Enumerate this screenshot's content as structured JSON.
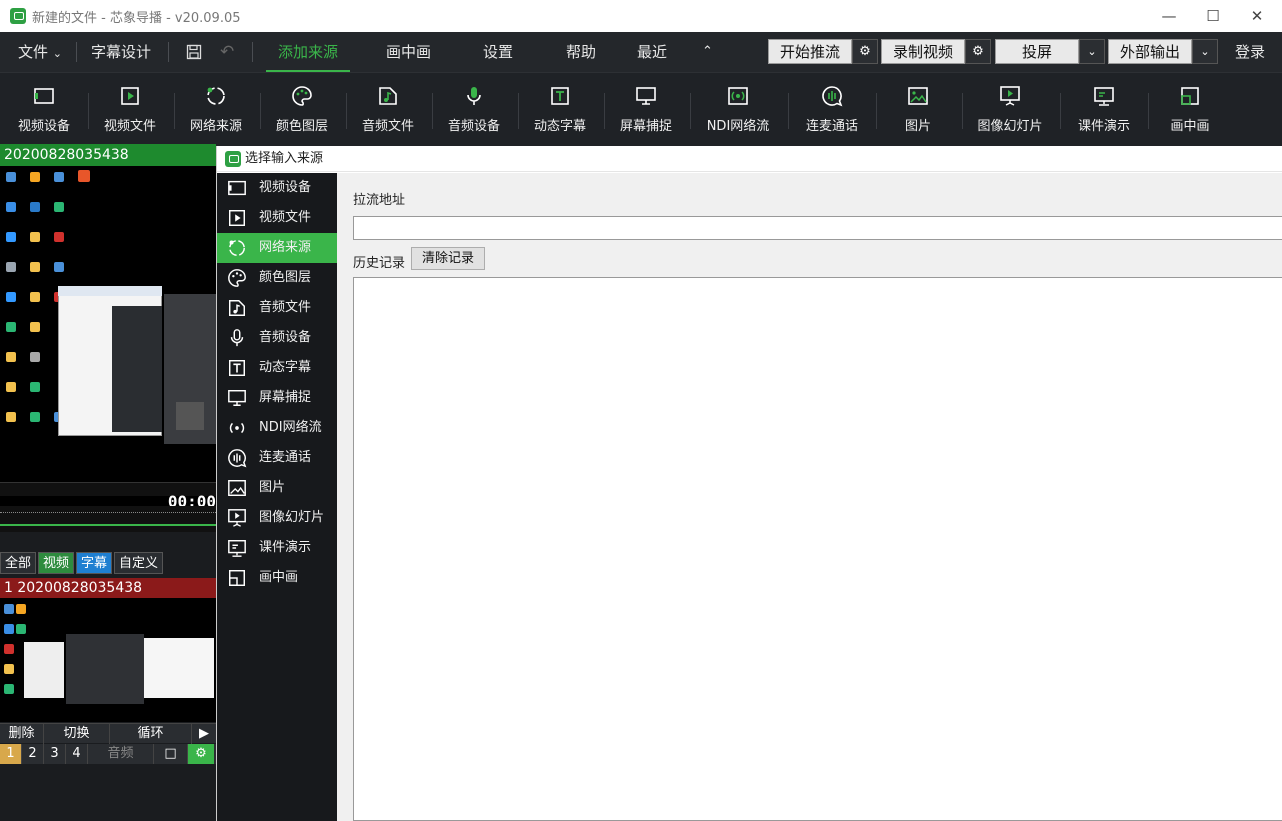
{
  "titlebar": {
    "title": "新建的文件 - 芯象导播 - v20.09.05",
    "minimize_icon": "minimize-icon",
    "maximize_icon": "maximize-icon",
    "close_icon": "close-icon"
  },
  "menubar": {
    "file": "文件",
    "subtitle_design": "字幕设计",
    "add_source": "添加来源",
    "pip": "画中画",
    "settings": "设置",
    "help": "帮助",
    "recent": "最近",
    "start_push": "开始推流",
    "record_video": "录制视频",
    "cast": "投屏",
    "external_output": "外部输出",
    "login": "登录"
  },
  "toolbar": {
    "items": [
      {
        "label": "视频设备",
        "icon": "video-device-icon"
      },
      {
        "label": "视频文件",
        "icon": "video-file-icon"
      },
      {
        "label": "网络来源",
        "icon": "network-source-icon"
      },
      {
        "label": "颜色图层",
        "icon": "palette-icon"
      },
      {
        "label": "音频文件",
        "icon": "audio-file-icon"
      },
      {
        "label": "音频设备",
        "icon": "microphone-icon"
      },
      {
        "label": "动态字幕",
        "icon": "text-icon"
      },
      {
        "label": "屏幕捕捉",
        "icon": "monitor-icon"
      },
      {
        "label": "NDI网络流",
        "icon": "ndi-icon"
      },
      {
        "label": "连麦通话",
        "icon": "voice-chat-icon"
      },
      {
        "label": "图片",
        "icon": "image-icon"
      },
      {
        "label": "图像幻灯片",
        "icon": "slideshow-icon"
      },
      {
        "label": "课件演示",
        "icon": "courseware-icon"
      },
      {
        "label": "画中画",
        "icon": "pip-icon"
      }
    ]
  },
  "left_panel": {
    "preview_title": "20200828035438",
    "timecode": "00:00",
    "filters": [
      "全部",
      "视频",
      "字幕",
      "自定义"
    ],
    "list_item_title": "1 20200828035438",
    "controls": [
      "删除",
      "切换",
      "循环"
    ],
    "numbers": [
      "1",
      "2",
      "3",
      "4"
    ],
    "audio_label": "音频"
  },
  "dialog": {
    "title": "选择输入来源",
    "side_items": [
      {
        "label": "视频设备",
        "icon": "video-device-icon"
      },
      {
        "label": "视频文件",
        "icon": "video-file-icon"
      },
      {
        "label": "网络来源",
        "icon": "network-source-icon",
        "selected": true
      },
      {
        "label": "颜色图层",
        "icon": "palette-icon"
      },
      {
        "label": "音频文件",
        "icon": "audio-file-icon"
      },
      {
        "label": "音频设备",
        "icon": "microphone-icon"
      },
      {
        "label": "动态字幕",
        "icon": "text-icon"
      },
      {
        "label": "屏幕捕捉",
        "icon": "monitor-icon"
      },
      {
        "label": "NDI网络流",
        "icon": "ndi-icon"
      },
      {
        "label": "连麦通话",
        "icon": "voice-chat-icon"
      },
      {
        "label": "图片",
        "icon": "image-icon"
      },
      {
        "label": "图像幻灯片",
        "icon": "slideshow-icon"
      },
      {
        "label": "课件演示",
        "icon": "courseware-icon"
      },
      {
        "label": "画中画",
        "icon": "pip-icon"
      }
    ],
    "pull_url_label": "拉流地址",
    "pull_url_value": "",
    "history_label": "历史记录",
    "clear_history": "清除记录"
  },
  "colors": {
    "accent": "#3ab54a",
    "record_red": "#8b1a1a"
  }
}
